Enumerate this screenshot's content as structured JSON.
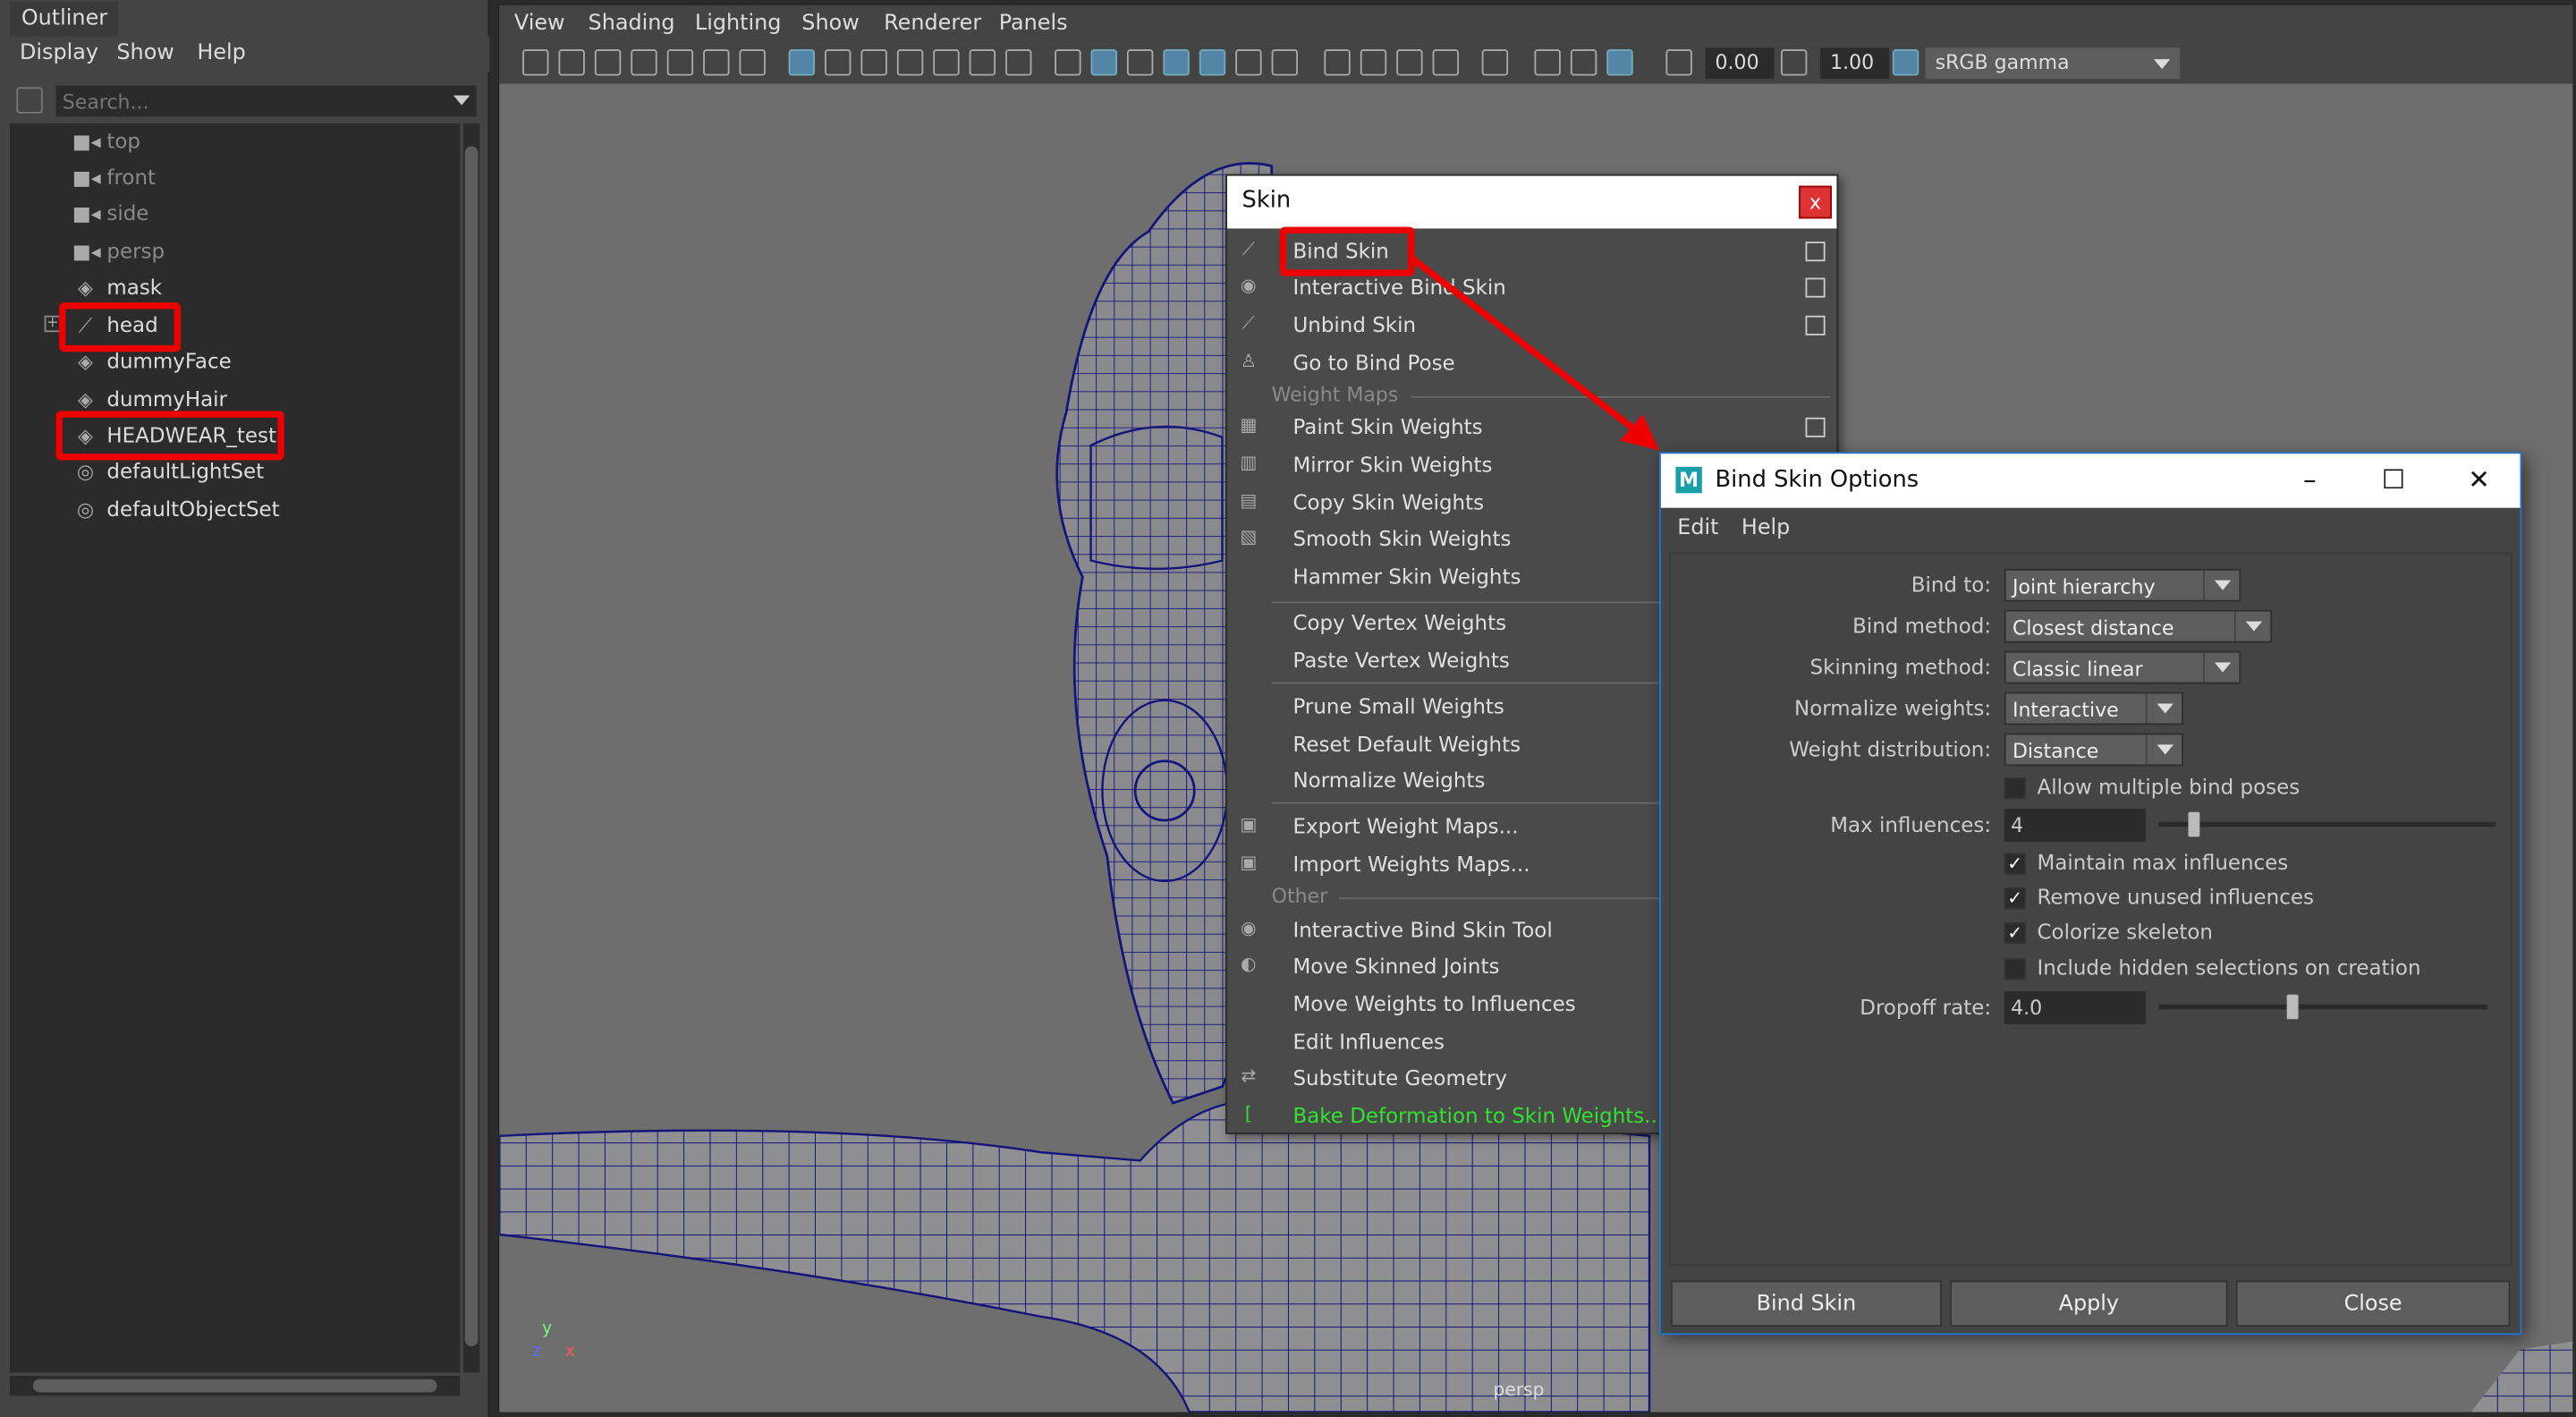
{
  "outliner": {
    "title": "Outliner",
    "menu": [
      "Display",
      "Show",
      "Help"
    ],
    "search_placeholder": "Search...",
    "items": [
      {
        "label": "top",
        "icon": "camera-icon",
        "dim": true
      },
      {
        "label": "front",
        "icon": "camera-icon",
        "dim": true
      },
      {
        "label": "side",
        "icon": "camera-icon",
        "dim": true
      },
      {
        "label": "persp",
        "icon": "camera-icon",
        "dim": true
      },
      {
        "label": "mask",
        "icon": "mesh-icon",
        "dim": false
      },
      {
        "label": "head",
        "icon": "joint-icon",
        "dim": false,
        "expandable": true,
        "highlighted": true
      },
      {
        "label": "dummyFace",
        "icon": "mesh-icon",
        "dim": false
      },
      {
        "label": "dummyHair",
        "icon": "mesh-icon",
        "dim": false
      },
      {
        "label": "HEADWEAR_test",
        "icon": "mesh-icon",
        "dim": false,
        "highlighted": true
      },
      {
        "label": "defaultLightSet",
        "icon": "set-icon",
        "dim": false
      },
      {
        "label": "defaultObjectSet",
        "icon": "set-icon",
        "dim": false
      }
    ]
  },
  "viewport": {
    "menu": [
      "View",
      "Shading",
      "Lighting",
      "Show",
      "Renderer",
      "Panels"
    ],
    "exposure": "0.00",
    "gamma": "1.00",
    "color_space": "sRGB gamma",
    "camera_label": "persp",
    "axis": {
      "x": "x",
      "y": "y",
      "z": "z"
    }
  },
  "skin_menu": {
    "title": "Skin",
    "close": "x",
    "items": [
      {
        "label": "Bind Skin",
        "option": true,
        "highlighted": true
      },
      {
        "label": "Interactive Bind Skin",
        "option": true
      },
      {
        "label": "Unbind Skin",
        "option": true
      },
      {
        "label": "Go to Bind Pose",
        "option": false
      }
    ],
    "section_weight_maps": "Weight Maps",
    "weight_items": [
      {
        "label": "Paint Skin Weights",
        "option": true
      },
      {
        "label": "Mirror Skin Weights"
      },
      {
        "label": "Copy Skin Weights"
      },
      {
        "label": "Smooth Skin Weights"
      },
      {
        "label": "Hammer Skin Weights"
      }
    ],
    "vertex_items": [
      "Copy Vertex Weights",
      "Paste Vertex Weights"
    ],
    "weight_ops": [
      "Prune Small Weights",
      "Reset Default Weights",
      "Normalize Weights"
    ],
    "map_io": [
      "Export Weight Maps...",
      "Import Weights Maps..."
    ],
    "section_other": "Other",
    "other_items": [
      "Interactive Bind Skin Tool",
      "Move Skinned Joints",
      "Move Weights to Influences",
      "Edit Influences",
      "Substitute Geometry"
    ],
    "bake_item": "Bake Deformation to Skin Weights..."
  },
  "dialog": {
    "title": "Bind Skin Options",
    "menu": [
      "Edit",
      "Help"
    ],
    "bind_to_label": "Bind to:",
    "bind_to": "Joint hierarchy",
    "bind_method_label": "Bind method:",
    "bind_method": "Closest distance",
    "skinning_method_label": "Skinning method:",
    "skinning_method": "Classic linear",
    "normalize_label": "Normalize weights:",
    "normalize": "Interactive",
    "distribution_label": "Weight distribution:",
    "distribution": "Distance",
    "allow_multiple": "Allow multiple bind poses",
    "max_influences_label": "Max influences:",
    "max_influences": "4",
    "maintain_max": "Maintain max influences",
    "remove_unused": "Remove unused influences",
    "colorize": "Colorize skeleton",
    "include_hidden": "Include hidden selections on creation",
    "dropoff_label": "Dropoff rate:",
    "dropoff": "4.0",
    "buttons": {
      "bind": "Bind Skin",
      "apply": "Apply",
      "close": "Close"
    }
  },
  "colors": {
    "highlight_red": "#e00000",
    "green_item": "#31e231",
    "wire_blue": "#1a1a8a"
  }
}
